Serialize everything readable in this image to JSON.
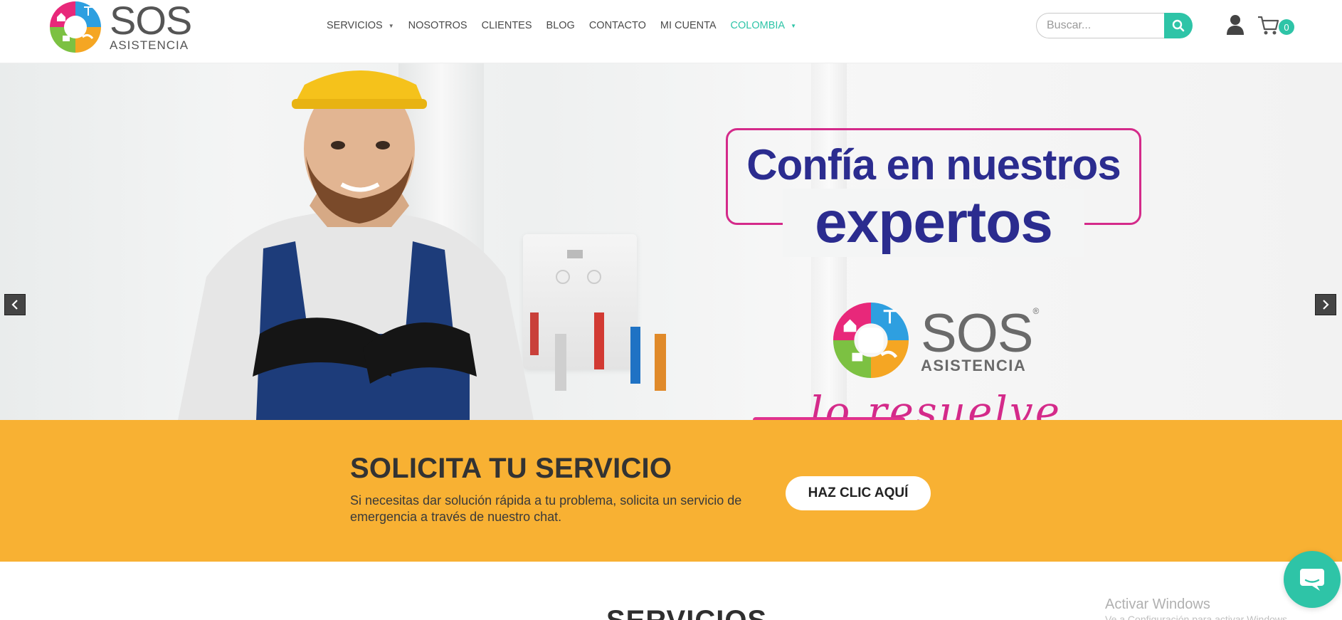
{
  "brand": {
    "name": "SOS",
    "tagline": "ASISTENCIA",
    "colors": {
      "accent": "#2ec4a7",
      "navy": "#2b2c8f",
      "magenta": "#d42a8a",
      "cta_band": "#f8b133",
      "logo_blue": "#2e9fe0",
      "logo_green": "#7cc142",
      "logo_orange": "#f5a623",
      "logo_pink": "#e8287a"
    }
  },
  "nav": {
    "items": [
      {
        "label": "SERVICIOS",
        "has_dropdown": true,
        "active": false
      },
      {
        "label": "NOSOTROS",
        "has_dropdown": false,
        "active": false
      },
      {
        "label": "CLIENTES",
        "has_dropdown": false,
        "active": false
      },
      {
        "label": "BLOG",
        "has_dropdown": false,
        "active": false
      },
      {
        "label": "CONTACTO",
        "has_dropdown": false,
        "active": false
      },
      {
        "label": "MI CUENTA",
        "has_dropdown": false,
        "active": false
      },
      {
        "label": "COLOMBIA",
        "has_dropdown": true,
        "active": true
      }
    ],
    "caret_glyph": "▼"
  },
  "search": {
    "placeholder": "Buscar...",
    "icon": "search-icon"
  },
  "account": {
    "icon": "user-icon"
  },
  "cart": {
    "icon": "cart-icon",
    "count": "0"
  },
  "hero": {
    "headline_line1": "Confía en nuestros",
    "headline_line2": "expertos",
    "logo_name": "SOS",
    "logo_mark": "®",
    "logo_tagline": "ASISTENCIA",
    "script_text": "lo resuelve",
    "prev_icon": "chevron-left-icon",
    "next_icon": "chevron-right-icon"
  },
  "cta": {
    "title": "SOLICITA TU SERVICIO",
    "text": "Si necesitas dar solución rápida a tu problema, solicita un servicio de emergencia a través de nuestro chat.",
    "button_label": "HAZ CLIC AQUÍ"
  },
  "section": {
    "title": "SERVICIOS"
  },
  "watermark": {
    "line1": "Activar Windows",
    "line2": "Ve a Configuración para activar Windows."
  },
  "chat": {
    "icon": "chat-bubble-icon"
  }
}
